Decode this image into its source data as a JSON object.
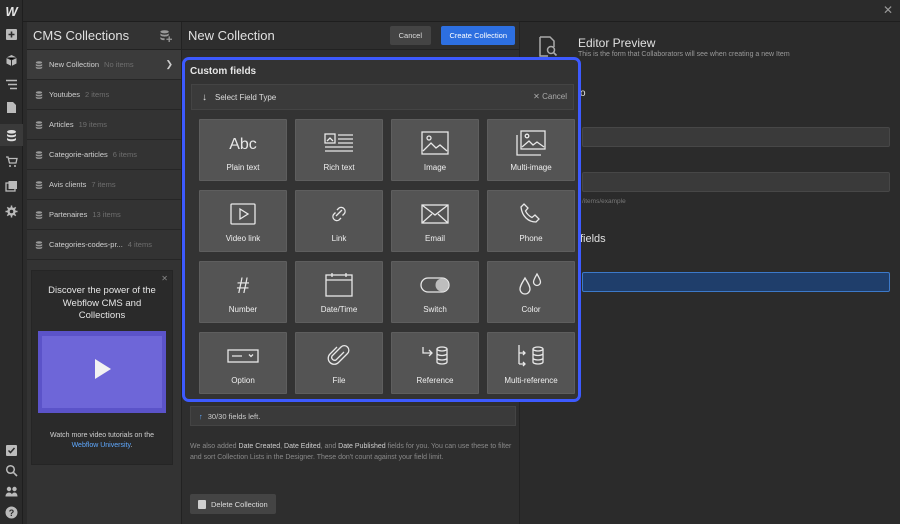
{
  "rail": {
    "logo": "W",
    "icons": [
      "add-icon",
      "box-icon",
      "navigator-icon",
      "pages-icon",
      "cms-icon",
      "ecommerce-icon",
      "assets-icon",
      "settings-icon",
      "tasks-icon",
      "search-icon",
      "users-icon",
      "help-icon"
    ]
  },
  "collections": {
    "title": "CMS Collections",
    "items": [
      {
        "name": "New Collection",
        "count": "No items"
      },
      {
        "name": "Youtubes",
        "count": "2 items"
      },
      {
        "name": "Articles",
        "count": "19 items"
      },
      {
        "name": "Categorie-articles",
        "count": "6 items"
      },
      {
        "name": "Avis clients",
        "count": "7 items"
      },
      {
        "name": "Partenaires",
        "count": "13 items"
      },
      {
        "name": "Categories-codes-pr...",
        "count": "4 items"
      }
    ],
    "promo": {
      "title": "Discover the power of the Webflow CMS and Collections",
      "footer": "Watch more video tutorials on the",
      "link": "Webflow University",
      "period": "."
    }
  },
  "new_collection": {
    "title": "New Collection",
    "cancel": "Cancel",
    "create": "Create Collection",
    "fields_left": "30/30 fields left.",
    "info_parts": [
      "We also added ",
      "Date Created",
      ", ",
      "Date Edited",
      ", and ",
      "Date Published",
      " fields for you. You can use these to filter and sort Collection Lists in the Designer. These don't count against your field limit."
    ],
    "delete": "Delete Collection"
  },
  "preview": {
    "title": "Editor Preview",
    "subtitle": "This is the form that Collaborators will see when creating a new Item",
    "frag_o": "o",
    "slug_hint": "/items/example",
    "frag_fields": "fields"
  },
  "modal": {
    "title": "Custom fields",
    "select_label": "Select Field Type",
    "cancel": "Cancel",
    "tiles": [
      {
        "label": "Plain text",
        "icon": "plain-text-icon"
      },
      {
        "label": "Rich text",
        "icon": "rich-text-icon"
      },
      {
        "label": "Image",
        "icon": "image-icon"
      },
      {
        "label": "Multi-image",
        "icon": "multi-image-icon"
      },
      {
        "label": "Video link",
        "icon": "video-icon"
      },
      {
        "label": "Link",
        "icon": "link-icon"
      },
      {
        "label": "Email",
        "icon": "email-icon"
      },
      {
        "label": "Phone",
        "icon": "phone-icon"
      },
      {
        "label": "Number",
        "icon": "number-icon"
      },
      {
        "label": "Date/Time",
        "icon": "calendar-icon"
      },
      {
        "label": "Switch",
        "icon": "switch-icon"
      },
      {
        "label": "Color",
        "icon": "color-icon"
      },
      {
        "label": "Option",
        "icon": "option-icon"
      },
      {
        "label": "File",
        "icon": "file-icon"
      },
      {
        "label": "Reference",
        "icon": "reference-icon"
      },
      {
        "label": "Multi-reference",
        "icon": "multi-reference-icon"
      }
    ],
    "plain_text_glyph": "Abc",
    "number_glyph": "#"
  },
  "colors": {
    "accent": "#3d5afe",
    "primary_button": "#2d6fe0",
    "link": "#5fa9ff"
  }
}
